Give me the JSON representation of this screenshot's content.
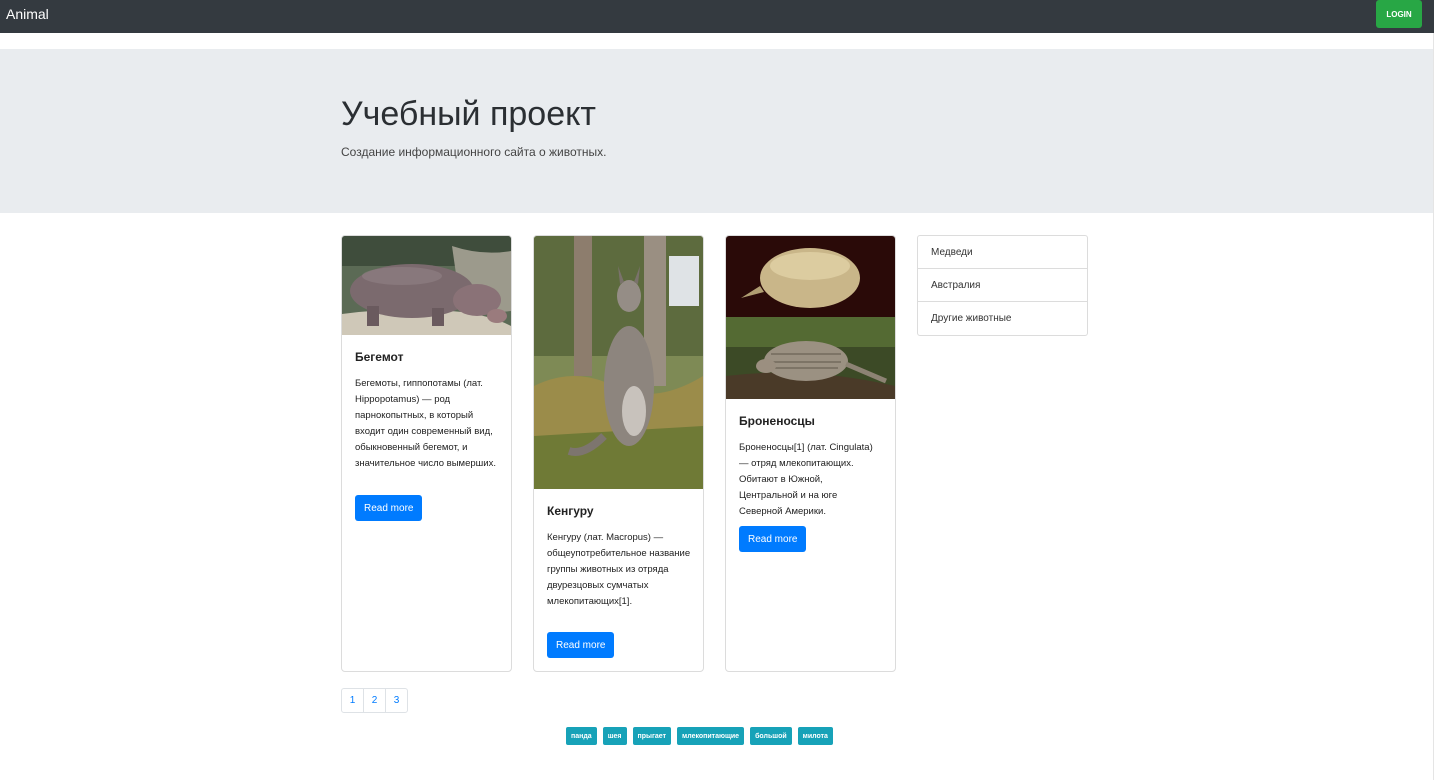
{
  "navbar": {
    "brand": "Animal",
    "login_label": "LOGIN"
  },
  "jumbotron": {
    "title": "Учебный проект",
    "subtitle": "Создание информационного сайта о животных."
  },
  "cards": [
    {
      "title": "Бегемот",
      "text": "Бегемоты, гиппопотамы (лат. Hippopotamus) — род парнокопытных, в который входит один современный вид, обыкновенный бегемот, и значительное число вымерших.",
      "button": "Read more"
    },
    {
      "title": "Кенгуру",
      "text": "Кенгуру (лат. Macropus) — общеупотребительное название группы животных из отряда двурезцовых сумчатых млекопитающих[1].",
      "button": "Read more"
    },
    {
      "title": "Броненосцы",
      "text": "Броненосцы[1] (лат. Cingulata) — отряд млекопитающих. Обитают в Южной, Центральной и на юге Северной Америки.",
      "button": "Read more"
    }
  ],
  "sidebar": {
    "items": [
      {
        "label": "Медведи"
      },
      {
        "label": "Австралия"
      },
      {
        "label": "Другие животные"
      }
    ]
  },
  "pagination": {
    "pages": [
      "1",
      "2",
      "3"
    ]
  },
  "tags": [
    "панда",
    "шея",
    "прыгает",
    "млекопитающие",
    "большой",
    "милота"
  ],
  "colors": {
    "navbar": "#343a40",
    "login": "#28a745",
    "primary": "#007bff",
    "tag": "#17a2b8",
    "jumbotron": "#e9ecef"
  }
}
